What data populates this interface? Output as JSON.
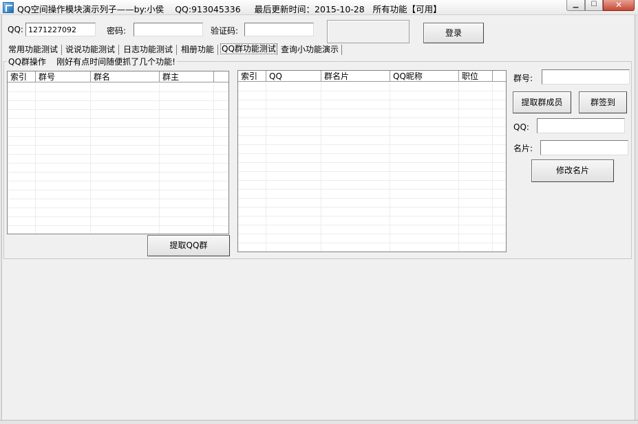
{
  "window": {
    "title": "QQ空间操作模块演示列子——by:小侯    QQ:913045336     最后更新时间：2015-10-28   所有功能【可用】",
    "min_icon": "minimize-icon",
    "max_icon": "maximize-icon",
    "close_icon": "close-icon"
  },
  "login": {
    "qq_label": "QQ:",
    "qq_value": "1271227092",
    "password_label": "密码:",
    "password_value": "",
    "captcha_label": "验证码:",
    "captcha_value": "",
    "login_button": "登录"
  },
  "tabs": [
    {
      "label": "常用功能测试"
    },
    {
      "label": "说说功能测试"
    },
    {
      "label": "日志功能测试"
    },
    {
      "label": "相册功能"
    },
    {
      "label": "QQ群功能测试",
      "active": true
    },
    {
      "label": "查询小功能演示"
    }
  ],
  "group": {
    "title": "QQ群操作    刚好有点时间随便抓了几个功能!"
  },
  "group_list": {
    "columns": [
      "索引",
      "群号",
      "群名",
      "群主"
    ],
    "rows": [],
    "fetch_button": "提取QQ群"
  },
  "member_list": {
    "columns": [
      "索引",
      "QQ",
      "群名片",
      "QQ昵称",
      "职位"
    ],
    "rows": []
  },
  "side_panel": {
    "group_no_label": "群号:",
    "group_no_value": "",
    "fetch_members_button": "提取群成员",
    "checkin_button": "群签到",
    "qq_label": "QQ:",
    "qq_value": "",
    "card_label": "名片:",
    "card_value": "",
    "edit_card_button": "修改名片"
  }
}
